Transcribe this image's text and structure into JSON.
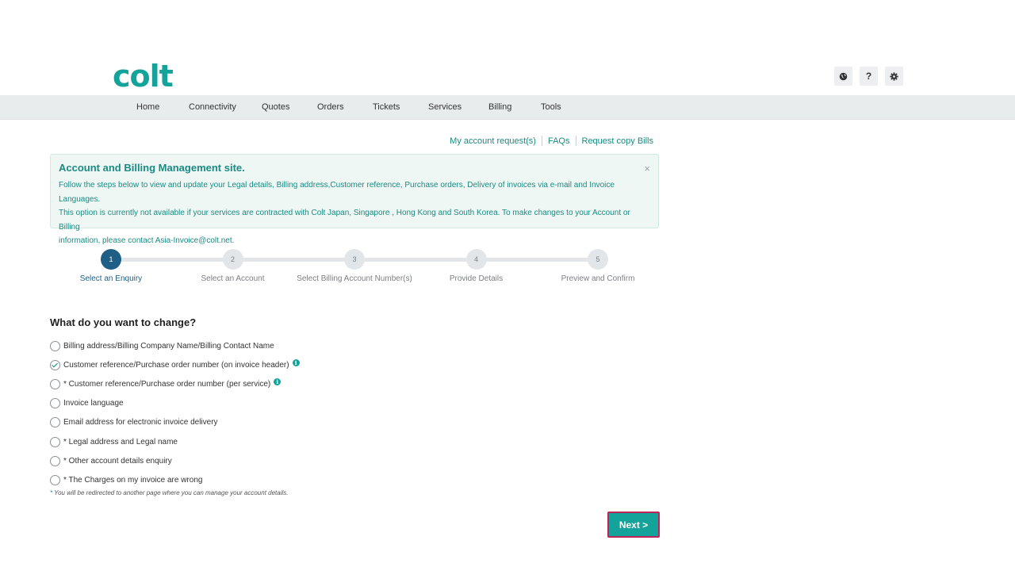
{
  "brand": {
    "logo_text": "colt",
    "accent_color": "#14a39a"
  },
  "utility_icons": [
    {
      "name": "globe-icon",
      "glyph": "◉"
    },
    {
      "name": "help-icon",
      "glyph": "?"
    },
    {
      "name": "settings-icon",
      "glyph": "⚙"
    }
  ],
  "nav": {
    "items": [
      "Home",
      "Connectivity",
      "Quotes",
      "Orders",
      "Tickets",
      "Services",
      "Billing",
      "Tools"
    ]
  },
  "top_links": [
    "My account request(s)",
    "FAQs",
    "Request copy Bills"
  ],
  "info_box": {
    "title": "Account and Billing Management site.",
    "line1": "Follow the steps below to view and update your Legal details, Billing address,Customer reference, Purchase orders, Delivery of invoices via e-mail and Invoice Languages.",
    "line2": "This option is currently not available if your services are contracted with Colt Japan, Singapore , Hong Kong and South Korea. To make changes to your Account or Billing",
    "line3": "information, please contact Asia-Invoice@colt.net.",
    "close": "×"
  },
  "steps": [
    {
      "num": "1",
      "label": "Select an Enquiry",
      "active": true
    },
    {
      "num": "2",
      "label": "Select an Account",
      "active": false
    },
    {
      "num": "3",
      "label": "Select Billing Account Number(s)",
      "active": false
    },
    {
      "num": "4",
      "label": "Provide Details",
      "active": false
    },
    {
      "num": "5",
      "label": "Preview and Confirm",
      "active": false
    }
  ],
  "form": {
    "question": "What do you want to change?",
    "options": [
      {
        "label": "Billing address/Billing Company Name/Billing Contact Name",
        "checked": false,
        "info": false
      },
      {
        "label": "Customer reference/Purchase order number (on invoice header)",
        "checked": true,
        "info": true
      },
      {
        "label": "* Customer reference/Purchase order number (per service)",
        "checked": false,
        "info": true
      },
      {
        "label": "Invoice language",
        "checked": false,
        "info": false
      },
      {
        "label": "Email address for electronic invoice delivery",
        "checked": false,
        "info": false
      },
      {
        "label": "* Legal address and Legal name",
        "checked": false,
        "info": false
      },
      {
        "label": "* Other account details enquiry",
        "checked": false,
        "info": false
      },
      {
        "label": "* The Charges on my invoice are wrong",
        "checked": false,
        "info": false
      }
    ],
    "footnote_star": "*",
    "footnote": "You will be redirected to another page where you can manage your account details.",
    "next_label": "Next >"
  }
}
